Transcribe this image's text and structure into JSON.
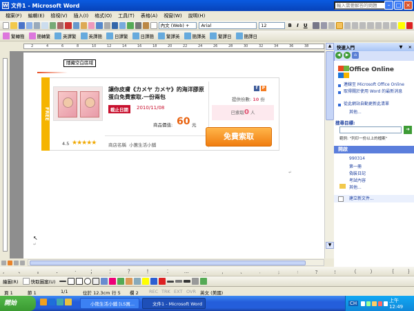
{
  "window": {
    "title": "文件1 - Microsoft Word",
    "help_placeholder": "輸入需要解答的問題",
    "tooltip": "TSHD"
  },
  "menu": [
    "檔案(F)",
    "編輯(E)",
    "檢視(V)",
    "插入(I)",
    "格式(O)",
    "工具(T)",
    "表格(A)",
    "視窗(W)",
    "說明(H)"
  ],
  "toolbar": {
    "style": "內文 (Web) +",
    "font": "Arial",
    "size": "12",
    "review_items": [
      "繁轉簡",
      "簡轉繁",
      "英譯繁",
      "英譯簡",
      "日譯繁",
      "日譯簡",
      "繁譯英",
      "簡譯英",
      "繁譯日",
      "簡譯日"
    ]
  },
  "ruler_ticks": [
    "2",
    "4",
    "6",
    "8",
    "10",
    "12",
    "14",
    "16",
    "18",
    "20",
    "22",
    "24",
    "26",
    "28",
    "30",
    "32",
    "34",
    "36",
    "38"
  ],
  "doc": {
    "hidden_label": "隱藏空白區域",
    "free_label": "FREE",
    "product_title": "讓你皮膚《カメヤ カメヤ》的海洋膠原蛋白免費索取.一份兩包",
    "expire_label": "截止日期",
    "expire_date": "2010/11/08",
    "price_label": "商品價值:",
    "price": "60",
    "price_unit": "元",
    "rating": "4.5",
    "stars": "★★★★★",
    "shop_label": "商店名稱",
    "shop_name": "小蕙生活小舖",
    "supply_label": "提供份數:",
    "supply_count": "10",
    "supply_unit": "份",
    "claimed_label": "已索取",
    "claimed_count": "0",
    "claimed_unit": "人",
    "claim_button": "免費索取"
  },
  "taskpane": {
    "title": "快速入門",
    "office_online": "Office Online",
    "links": [
      "連線至 Microsoft Office Online",
      "取得關於使用 Word 的最新消息",
      "從此網站自動更新此清單"
    ],
    "more": "其他...",
    "search_title": "搜尋目標:",
    "search_example": "範例: \"列印一份以上的檔案\"",
    "open_title": "開啟",
    "files": [
      "990314",
      "第一冊",
      "偽裝日記",
      "考試內容"
    ],
    "open_more": "其他...",
    "new_doc": "建立新文件..."
  },
  "drawbar": {
    "draw_label": "繪圖(R)",
    "autoshape_label": "快取圖案(U)"
  },
  "status": {
    "page": "頁 1",
    "section": "節 1",
    "pages": "1/1",
    "at": "位於 12.3cm",
    "line": "行 5",
    "col": "欄 2",
    "rec": "REC",
    "trk": "TRK",
    "ext": "EXT",
    "ovr": "OVR",
    "lang": "英文 (美國)"
  },
  "taskbar": {
    "start": "開始",
    "apps": [
      "小熊生活小舖 [LS買...",
      "文件1 - Microsoft Word"
    ],
    "ime": "CH",
    "time": "上午 12:49"
  }
}
